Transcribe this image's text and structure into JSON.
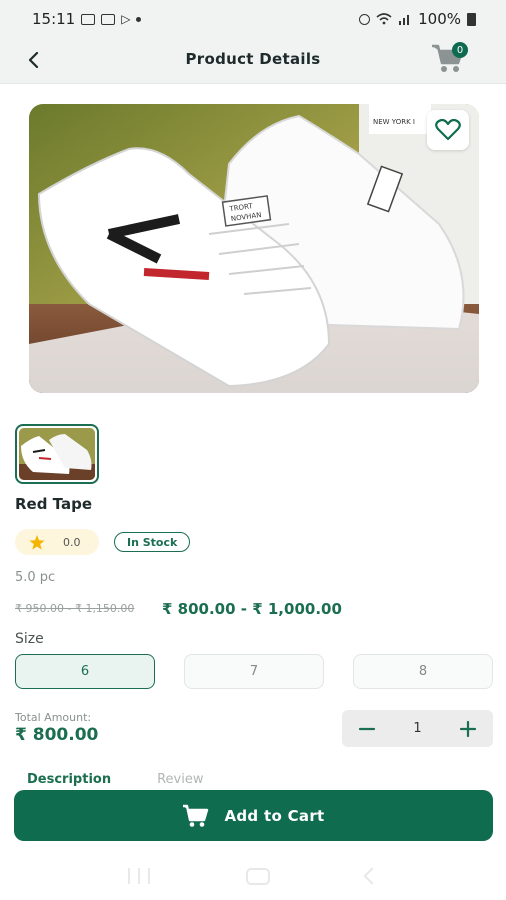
{
  "status_bar": {
    "time": "15:11",
    "battery": "100%"
  },
  "header": {
    "title": "Product Details",
    "cart_count": "0"
  },
  "hero": {
    "brand_tag": "NEW YORK I",
    "shoe_text": "TRORT NOVHAN"
  },
  "product": {
    "name": "Red Tape",
    "rating": "0.0",
    "stock_status": "In Stock",
    "unit": "5.0 pc",
    "old_price": "₹ 950.00 - ₹ 1,150.00",
    "price_range": "₹ 800.00 - ₹ 1,000.00"
  },
  "size": {
    "label": "Size",
    "options": [
      "6",
      "7",
      "8"
    ],
    "selected": "6"
  },
  "total": {
    "label": "Total Amount:",
    "value": "₹ 800.00"
  },
  "quantity": {
    "value": "1"
  },
  "tabs": [
    "Description",
    "Review"
  ],
  "cta": {
    "label": "Add to Cart"
  },
  "colors": {
    "primary": "#106c4f",
    "accent_star": "#f4b400"
  }
}
